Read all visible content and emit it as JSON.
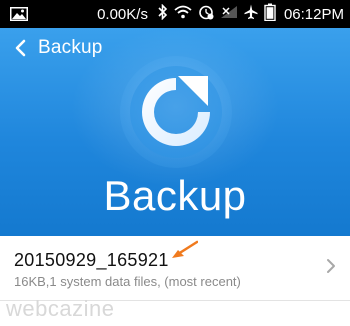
{
  "status_bar": {
    "network_speed": "0.00K/s",
    "time": "06:12PM",
    "icons": [
      "image-notification-icon",
      "bluetooth-icon",
      "wifi-icon",
      "alarm-icon",
      "signal-icon",
      "airplane-icon",
      "battery-icon"
    ]
  },
  "header": {
    "back_label": "Backup",
    "hero_title": "Backup",
    "colors": {
      "top": "#3aa0ec",
      "bottom": "#1479cf"
    }
  },
  "backups": [
    {
      "name": "20150929_165921",
      "details": "16KB,1  system data files,  (most recent)"
    }
  ],
  "annotation": {
    "arrow_color": "#f07a1e"
  },
  "watermark": "webcazine"
}
